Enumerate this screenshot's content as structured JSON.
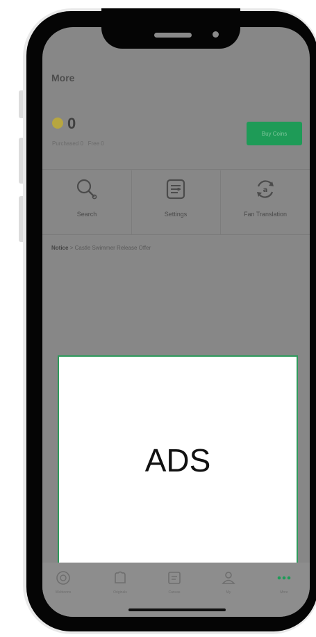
{
  "header": {
    "title": "More"
  },
  "wallet": {
    "coins": "0",
    "purchased_label": "Purchased 0",
    "free_label": "Free 0",
    "buy_button": "Buy Coins",
    "colors": {
      "coin": "#b7a640",
      "button": "#1e9b57"
    }
  },
  "tools": [
    {
      "label": "Search",
      "icon": "search-icon"
    },
    {
      "label": "Settings",
      "icon": "settings-icon"
    },
    {
      "label": "Fan Translation",
      "icon": "translation-icon"
    }
  ],
  "notice": {
    "label": "Notice",
    "separator": ">",
    "text": "Castle Swimmer Release Offer"
  },
  "ad": {
    "label": "ADS"
  },
  "tabs": [
    {
      "label": "Webtoons",
      "icon": "webtoons-icon"
    },
    {
      "label": "Originals",
      "icon": "originals-icon"
    },
    {
      "label": "Canvas",
      "icon": "canvas-icon"
    },
    {
      "label": "My",
      "icon": "profile-icon"
    },
    {
      "label": "More",
      "icon": "more-dots-icon",
      "active": true
    }
  ],
  "accent_color": "#1e9b57"
}
